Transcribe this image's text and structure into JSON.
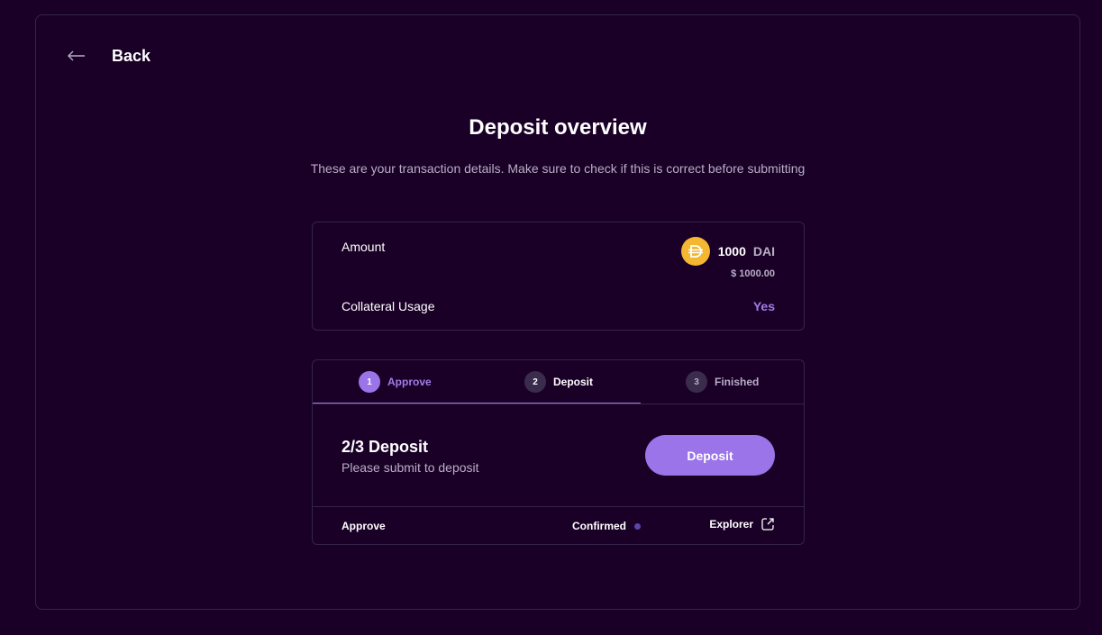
{
  "header": {
    "back_label": "Back",
    "back_icon": "arrow-left-icon"
  },
  "overview": {
    "title": "Deposit overview",
    "subtitle": "These are your transaction details. Make sure to check if this is correct before submitting",
    "amount_label": "Amount",
    "amount_value": "1000",
    "amount_symbol": "DAI",
    "amount_usd": "$ 1000.00",
    "token_icon": "dai-icon",
    "token_color": "#f4b731",
    "collateral_label": "Collateral Usage",
    "collateral_value": "Yes"
  },
  "steps": {
    "items": [
      {
        "number": "1",
        "label": "Approve",
        "state": "completed"
      },
      {
        "number": "2",
        "label": "Deposit",
        "state": "active"
      },
      {
        "number": "3",
        "label": "Finished",
        "state": "pending"
      }
    ],
    "current_title": "2/3 Deposit",
    "current_description": "Please submit to deposit",
    "action_button": "Deposit",
    "status_label": "Approve",
    "status_value": "Confirmed",
    "explorer_label": "Explorer",
    "explorer_icon": "external-link-icon"
  },
  "colors": {
    "background": "#1a0027",
    "accent": "#a07de8",
    "border": "#33244a"
  }
}
